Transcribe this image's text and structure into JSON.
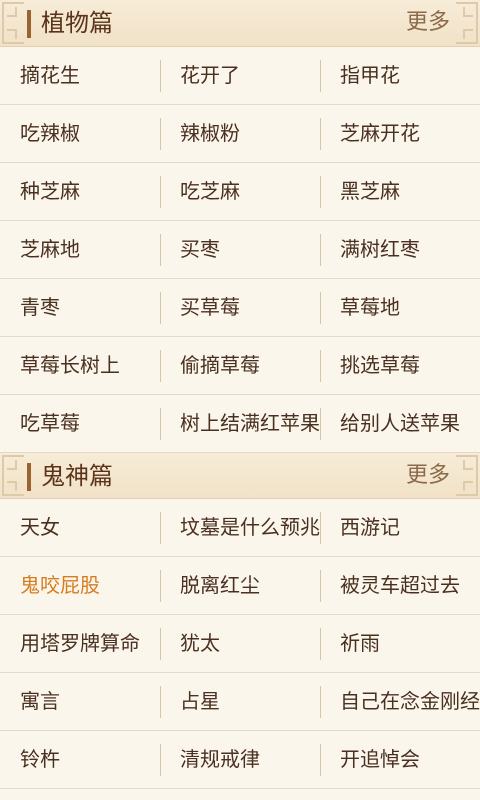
{
  "sections": [
    {
      "title": "植物篇",
      "more_label": "更多",
      "rows": [
        [
          "摘花生",
          "花开了",
          "指甲花"
        ],
        [
          "吃辣椒",
          "辣椒粉",
          "芝麻开花"
        ],
        [
          "种芝麻",
          "吃芝麻",
          "黑芝麻"
        ],
        [
          "芝麻地",
          "买枣",
          "满树红枣"
        ],
        [
          "青枣",
          "买草莓",
          "草莓地"
        ],
        [
          "草莓长树上",
          "偷摘草莓",
          "挑选草莓"
        ],
        [
          "吃草莓",
          "树上结满红苹果",
          "给别人送苹果"
        ]
      ]
    },
    {
      "title": "鬼神篇",
      "more_label": "更多",
      "rows": [
        [
          "天女",
          "坟墓是什么预兆",
          "西游记"
        ],
        [
          "鬼咬屁股",
          "脱离红尘",
          "被灵车超过去"
        ],
        [
          "用塔罗牌算命",
          "犹太",
          "祈雨"
        ],
        [
          "寓言",
          "占星",
          "自己在念金刚经"
        ],
        [
          "铃杵",
          "清规戒律",
          "开追悼会"
        ]
      ],
      "highlighted_item": "鬼咬屁股"
    }
  ],
  "colors": {
    "background": "#fbf6ec",
    "header": "#f3e6cf",
    "accent_bar": "#9a6330",
    "highlight_text": "#d67d20"
  },
  "icons": [
    "ornamental-corner-icon"
  ]
}
